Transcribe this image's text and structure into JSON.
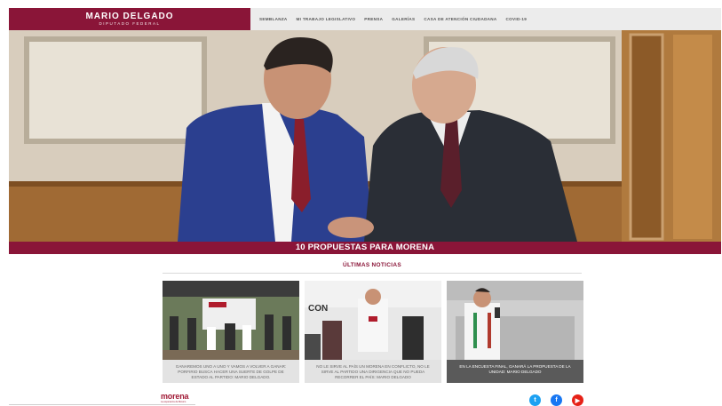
{
  "header": {
    "brand_name": "MARIO DELGADO",
    "brand_subtitle": "DIPUTADO FEDERAL",
    "nav": [
      "SEMBLANZA",
      "MI TRABAJO LEGISLATIVO",
      "PRENSA",
      "GALERÍAS",
      "CASA DE ATENCIÓN CIUDADANA",
      "COVID-19"
    ]
  },
  "hero": {
    "banner_text": "10 PROPUESTAS PARA MORENA"
  },
  "news": {
    "heading": "ÚLTIMAS NOTICIAS",
    "items": [
      {
        "caption": "GANAREMOS UNO A UNO Y VAMOS A VOLVER A GANAR: PORFIRIO BUSCA HACER UNA SUERTE DE GOLPE DE ESTADO AL PARTIDO: MARIO DELGADO."
      },
      {
        "caption": "NO LE SIRVE AL PAÍS UN MORENA EN CONFLICTO, NO LE SIRVE AL PARTIDO UNA DIRIGENCIA QUE NO PUEDA RECORRER EL PAÍS: MARIO DELGADO"
      },
      {
        "caption": "EN LA ENCUESTA FINAL, GANARÁ LA PROPUESTA DE LA UNIDAD: MARIO DELGADO"
      }
    ]
  },
  "footer": {
    "logo_text": "morena",
    "logo_subtext": "La esperanza de México",
    "social": [
      {
        "icon": "twitter-icon",
        "glyph": "t",
        "color": "#1da1f2"
      },
      {
        "icon": "facebook-icon",
        "glyph": "f",
        "color": "#1877f2"
      },
      {
        "icon": "youtube-icon",
        "glyph": "▶",
        "color": "#e62117"
      }
    ]
  },
  "colors": {
    "brand": "#8a1538",
    "header_bg": "#ececec"
  }
}
